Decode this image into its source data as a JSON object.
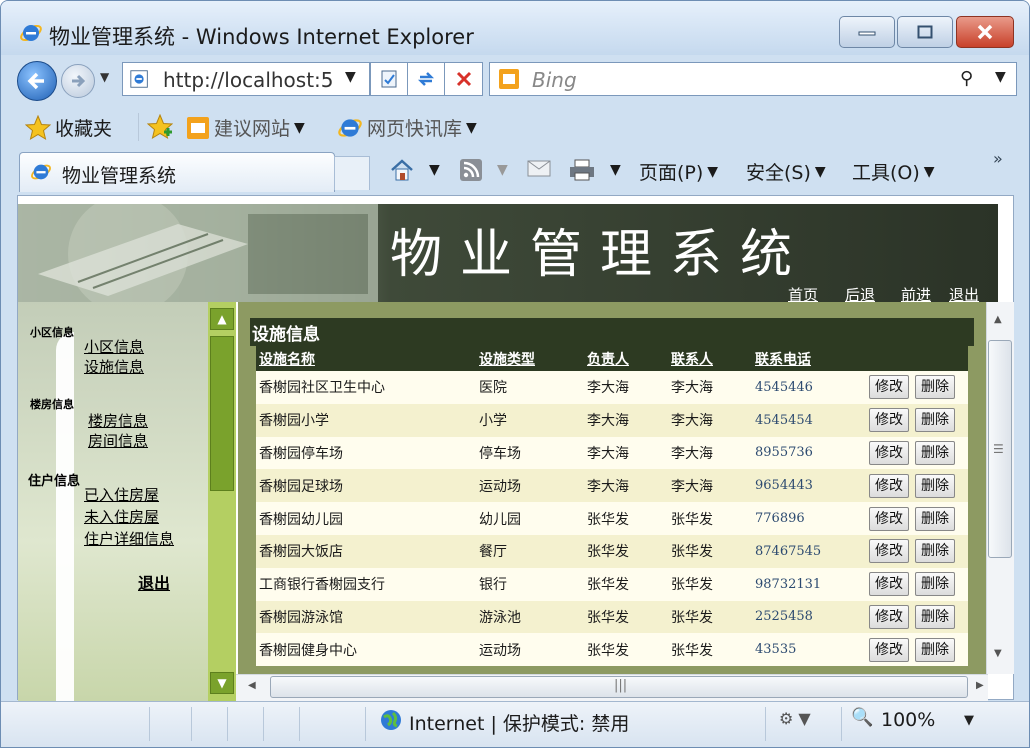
{
  "window": {
    "title": "物业管理系统 - Windows Internet Explorer"
  },
  "navigation": {
    "address": "http://localhost:5",
    "search_placeholder": "Bing"
  },
  "favorites_bar": {
    "favorites_label": "收藏夹",
    "suggested_sites": "建议网站",
    "web_slices": "网页快讯库"
  },
  "tab": {
    "label": "物业管理系统"
  },
  "command_bar": {
    "page": "页面(P)",
    "safety": "安全(S)",
    "tools": "工具(O)"
  },
  "page": {
    "banner_title": "物业管理系统",
    "top_links": [
      "首页",
      "后退",
      "前进",
      "退出"
    ],
    "sidebar": {
      "community_header": "小区信息",
      "community_info": "小区信息",
      "facility_info": "设施信息",
      "building_header": "楼房信息",
      "building_info": "楼房信息",
      "room_info": "房间信息",
      "resident_header": "住户信息",
      "occupied": "已入住房屋",
      "unoccupied": "未入住房屋",
      "resident_detail": "住户详细信息",
      "exit": "退出"
    },
    "section_title": "设施信息",
    "table": {
      "columns": [
        "设施名称",
        "设施类型",
        "负责人",
        "联系人",
        "联系电话"
      ],
      "edit_label": "修改",
      "delete_label": "删除",
      "rows": [
        {
          "name": "香榭园社区卫生中心",
          "type": "医院",
          "manager": "李大海",
          "contact": "李大海",
          "phone": "4545446"
        },
        {
          "name": "香榭园小学",
          "type": "小学",
          "manager": "李大海",
          "contact": "李大海",
          "phone": "4545454"
        },
        {
          "name": "香榭园停车场",
          "type": "停车场",
          "manager": "李大海",
          "contact": "李大海",
          "phone": "8955736"
        },
        {
          "name": "香榭园足球场",
          "type": "运动场",
          "manager": "李大海",
          "contact": "李大海",
          "phone": "9654443"
        },
        {
          "name": "香榭园幼儿园",
          "type": "幼儿园",
          "manager": "张华发",
          "contact": "张华发",
          "phone": "776896"
        },
        {
          "name": "香榭园大饭店",
          "type": "餐厅",
          "manager": "张华发",
          "contact": "张华发",
          "phone": "87467545"
        },
        {
          "name": "工商银行香榭园支行",
          "type": "银行",
          "manager": "张华发",
          "contact": "张华发",
          "phone": "98732131"
        },
        {
          "name": "香榭园游泳馆",
          "type": "游泳池",
          "manager": "张华发",
          "contact": "张华发",
          "phone": "2525458"
        },
        {
          "name": "香榭园健身中心",
          "type": "运动场",
          "manager": "张华发",
          "contact": "张华发",
          "phone": "43535"
        }
      ]
    }
  },
  "status_bar": {
    "zone": "Internet | 保护模式: 禁用",
    "zoom": "100%"
  },
  "colors": {
    "header_dark": "#2d3a22",
    "row_light": "#fffdee",
    "row_alt": "#f4f1cf",
    "frame_green": "#b4cf62"
  }
}
